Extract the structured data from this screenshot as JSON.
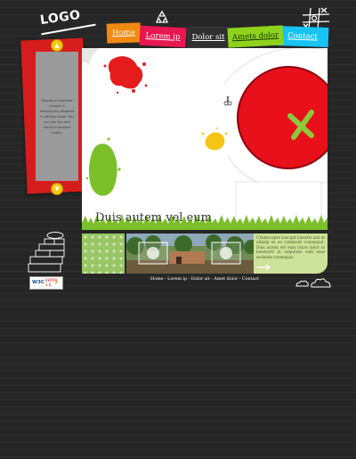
{
  "logo": {
    "text": "LOGO"
  },
  "nav": {
    "home": "Home",
    "lorem": "Lorem ip",
    "dolor": "Dolor sit",
    "amets": "Amets dolor",
    "contact": "Contact"
  },
  "sidebar": {
    "notice": "Display of selected images is temporarily disabled in editing mode. You can see the end result in preview mode."
  },
  "main": {
    "heading": "Duis autem vel eum"
  },
  "news": {
    "text": "Ullamcorper suscipit lobortis nisl ut aliquip ex ea commodo consequat. Duis autem vel eum iriure dolor in hendrerit in vulputate velit esse molestie consequat,"
  },
  "footer": {
    "links": "Home - Lorem ip - Dolor sit - Amet dolor - Contact"
  },
  "badge": {
    "line1": "W3C",
    "line2": "XHTML 1.0"
  },
  "colors": {
    "home_tab": "#f08a10",
    "lorem_tab": "#e8174f",
    "amets_tab": "#8ed21c",
    "contact_tab": "#16c3f3",
    "side_panel": "#d61d1d",
    "big_circle": "#e8101a",
    "grass": "#7bc02a"
  }
}
